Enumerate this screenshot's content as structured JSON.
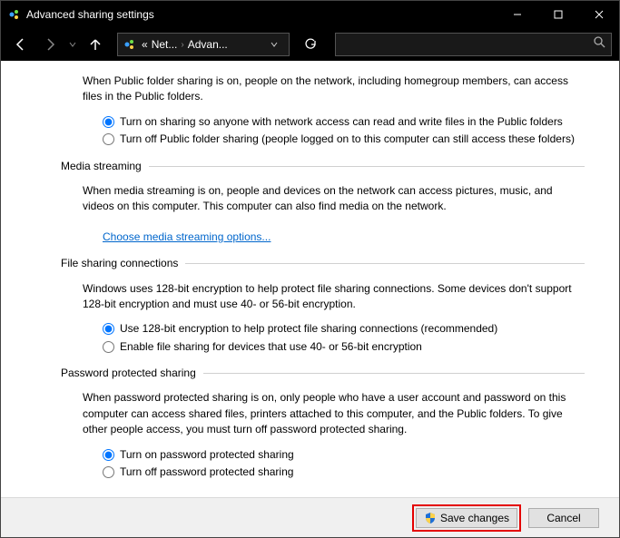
{
  "titlebar": {
    "title": "Advanced sharing settings"
  },
  "breadcrumb": {
    "prefix": "«",
    "item1": "Net...",
    "item2": "Advan..."
  },
  "public_folder": {
    "desc": "When Public folder sharing is on, people on the network, including homegroup members, can access files in the Public folders.",
    "opt_on": "Turn on sharing so anyone with network access can read and write files in the Public folders",
    "opt_off": "Turn off Public folder sharing (people logged on to this computer can still access these folders)"
  },
  "media": {
    "heading": "Media streaming",
    "desc": "When media streaming is on, people and devices on the network can access pictures, music, and videos on this computer. This computer can also find media on the network.",
    "link": "Choose media streaming options..."
  },
  "filesharing": {
    "heading": "File sharing connections",
    "desc": "Windows uses 128-bit encryption to help protect file sharing connections. Some devices don't support 128-bit encryption and must use 40- or 56-bit encryption.",
    "opt_128": "Use 128-bit encryption to help protect file sharing connections (recommended)",
    "opt_40": "Enable file sharing for devices that use 40- or 56-bit encryption"
  },
  "password": {
    "heading": "Password protected sharing",
    "desc": "When password protected sharing is on, only people who have a user account and password on this computer can access shared files, printers attached to this computer, and the Public folders. To give other people access, you must turn off password protected sharing.",
    "opt_on": "Turn on password protected sharing",
    "opt_off": "Turn off password protected sharing"
  },
  "footer": {
    "save": "Save changes",
    "cancel": "Cancel"
  }
}
